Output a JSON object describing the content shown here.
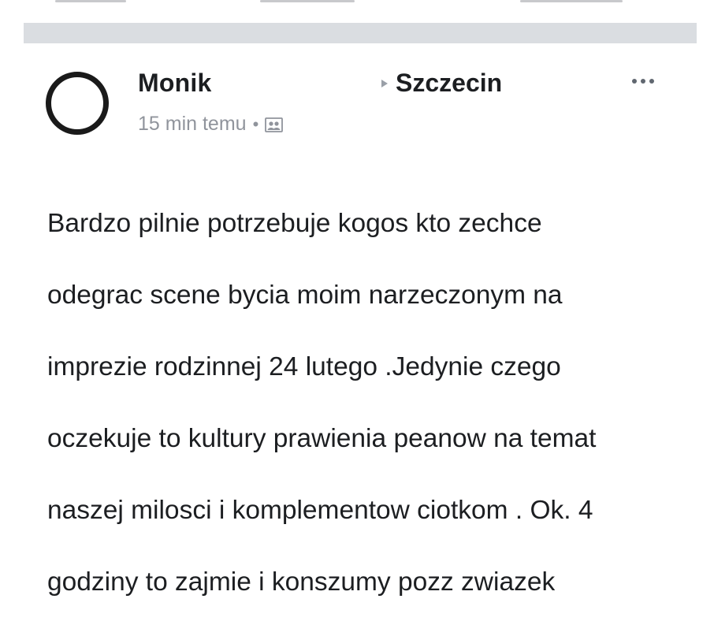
{
  "post": {
    "author": "Monik",
    "group": "Szczecin",
    "timestamp": "15 min temu",
    "separator": "•",
    "audience_icon": "group-audience-icon",
    "more_icon": "more-options-icon",
    "text_lines": [
      "Bardzo pilnie potrzebuje kogos kto zechce",
      "odegrac scene bycia moim narzeczonym na",
      "imprezie rodzinnej 24 lutego .Jedynie czego",
      "oczekuje to kultury prawienia peanow na temat",
      "naszej milosci i komplementow ciotkom . Ok. 4",
      "godziny to zajmie i konszumy pozz zwiazek"
    ]
  },
  "colors": {
    "text": "#1c1e21",
    "meta": "#90949c",
    "divider": "#dadde1",
    "avatar_ring": "#1a1a1a"
  }
}
